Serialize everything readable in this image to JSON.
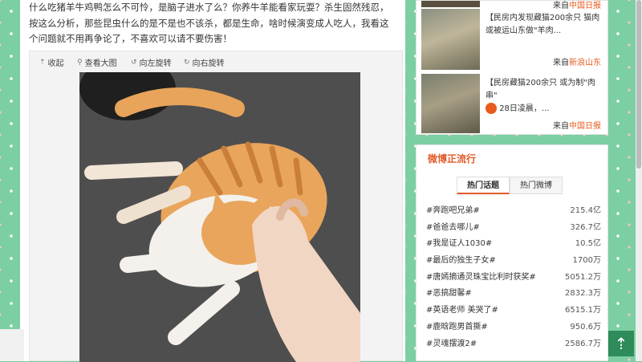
{
  "post": {
    "lines": [
      "什么吃猪羊牛鸡鸭怎么不可怜，是脑子进水了么？你养牛羊能看家玩耍？杀生固然残忍，",
      "按这么分析，那些昆虫什么的是不是也不该杀，都是生命，啥时候演变成人吃人，我看这",
      "个问题就不用再争论了，不喜欢可以请不要伤害！"
    ]
  },
  "toolbar": {
    "collapse": "收起",
    "view_large": "查看大图",
    "rotate_left": "向左旋转",
    "rotate_right": "向右旋转"
  },
  "news": {
    "source_prefix": "来自",
    "items": [
      {
        "source": "中国日报"
      },
      {
        "text": "【民房内发现藏猫200余只 猫肉或被运山东做\"羊肉...",
        "source": "新浪山东"
      },
      {
        "line1": "【民房藏猫200余只 或为制\"肉串\"",
        "line2": "28日凌晨，...",
        "source": "中国日报"
      }
    ]
  },
  "trending": {
    "title": "微博正流行",
    "tabs": [
      "热门话题",
      "热门微博"
    ],
    "rows": [
      {
        "topic": "#奔跑吧兄弟#",
        "count": "215.4亿"
      },
      {
        "topic": "#爸爸去哪儿#",
        "count": "326.7亿"
      },
      {
        "topic": "#我是证人1030#",
        "count": "10.5亿"
      },
      {
        "topic": "#最后的独生子女#",
        "count": "1700万"
      },
      {
        "topic": "#唐嫣摘通灵珠宝比利时获奖#",
        "count": "5051.2万"
      },
      {
        "topic": "#恶搞甜馨#",
        "count": "2832.3万"
      },
      {
        "topic": "#英语老师 美哭了#",
        "count": "6515.1万"
      },
      {
        "topic": "#鹿晗跑男首撕#",
        "count": "950.6万"
      },
      {
        "topic": "#灵魂摆渡2#",
        "count": "2586.7万"
      }
    ]
  },
  "back_to_top": {
    "glyph": "⇡"
  },
  "colors": {
    "background": "#7ccfa2",
    "accent": "#e05a2a",
    "source_red": "#e85a1e",
    "to_top": "#2e8b5a"
  }
}
